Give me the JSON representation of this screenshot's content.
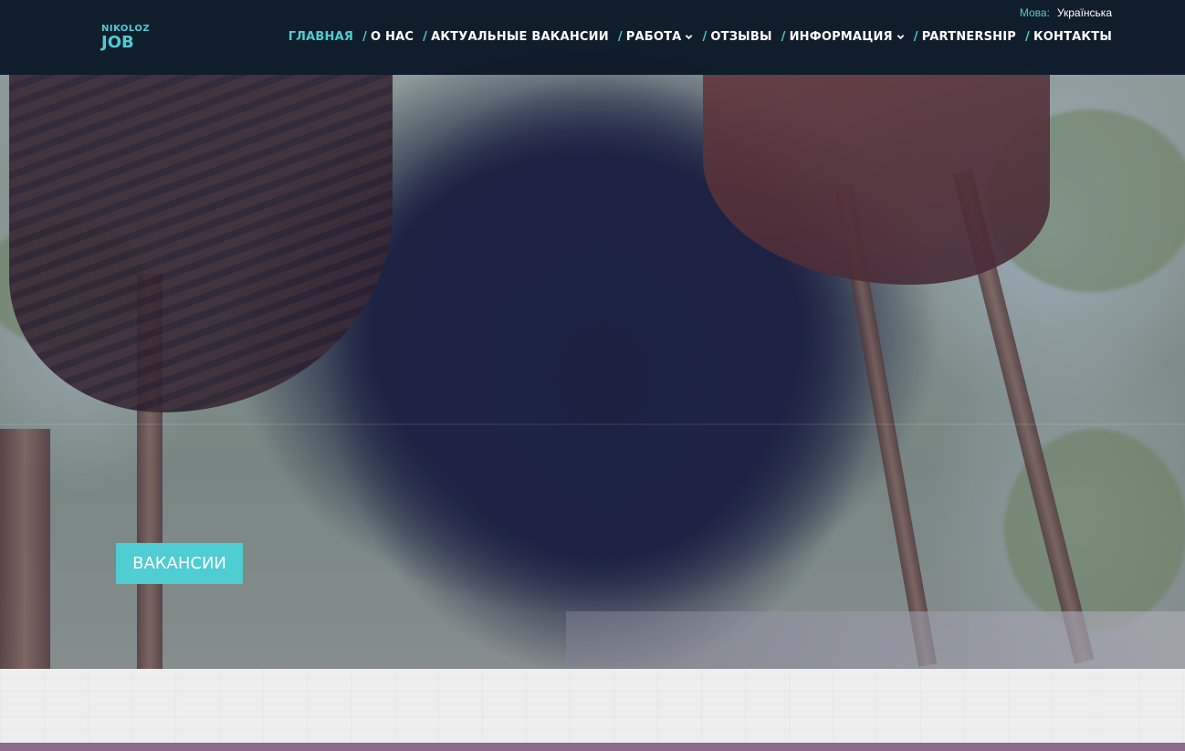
{
  "header": {
    "logo": {
      "line1": "NIKOLOZ",
      "line2": "JOB"
    },
    "language": {
      "label": "Мова:",
      "value": "Українська"
    },
    "nav": [
      {
        "label": "ГЛАВНАЯ",
        "active": true,
        "dropdown": false
      },
      {
        "label": "О НАС",
        "active": false,
        "dropdown": false
      },
      {
        "label": "АКТУАЛЬНЫЕ ВАКАНСИИ",
        "active": false,
        "dropdown": false
      },
      {
        "label": "РАБОТА",
        "active": false,
        "dropdown": true
      },
      {
        "label": "ОТЗЫВЫ",
        "active": false,
        "dropdown": false
      },
      {
        "label": "ИНФОРМАЦИЯ",
        "active": false,
        "dropdown": true
      },
      {
        "label": "PARTNERSHIP",
        "active": false,
        "dropdown": false
      },
      {
        "label": "КОНТАКТЫ",
        "active": false,
        "dropdown": false
      }
    ],
    "separator": "/"
  },
  "hero": {
    "cta_label": "ВАКАНСИИ"
  },
  "colors": {
    "accent": "#4ecdd2",
    "header_bg": "#05141f",
    "band": "#8b6a8b"
  }
}
